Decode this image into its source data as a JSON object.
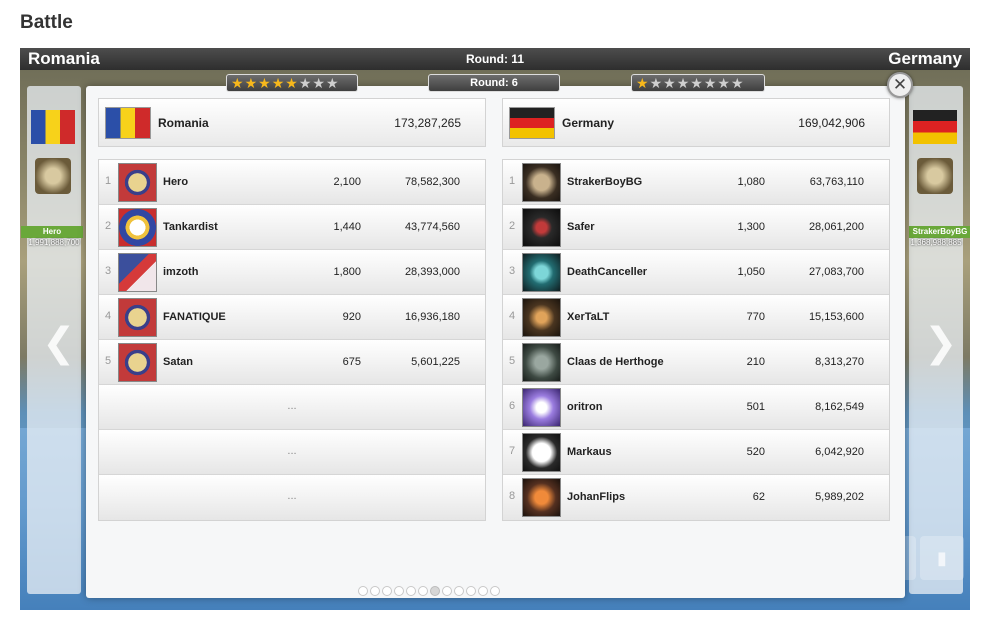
{
  "page": {
    "heading": "Battle"
  },
  "battle": {
    "attacker": "Romania",
    "defender": "Germany",
    "round_main": "Round: 11",
    "round_current": "Round: 6",
    "stars_left": {
      "filled": 5,
      "total": 8
    },
    "stars_right": {
      "filled": 1,
      "total": 8
    },
    "side_left": {
      "badge": "Hero",
      "value": "1,991,888,700"
    },
    "side_right": {
      "badge": "StrakerBoyBG",
      "value": "1,368,988,885"
    }
  },
  "left": {
    "country": "Romania",
    "total": "173,287,265",
    "flag": "romania-flag",
    "rows": [
      {
        "rank": "1",
        "name": "Hero",
        "kills": "2,100",
        "damage": "78,582,300"
      },
      {
        "rank": "2",
        "name": "Tankardist",
        "kills": "1,440",
        "damage": "43,774,560"
      },
      {
        "rank": "3",
        "name": "imzoth",
        "kills": "1,800",
        "damage": "28,393,000"
      },
      {
        "rank": "4",
        "name": "FANATIQUE",
        "kills": "920",
        "damage": "16,936,180"
      },
      {
        "rank": "5",
        "name": "Satan",
        "kills": "675",
        "damage": "5,601,225"
      }
    ],
    "empty_rows": [
      "...",
      "...",
      "..."
    ]
  },
  "right": {
    "country": "Germany",
    "total": "169,042,906",
    "flag": "germany-flag",
    "rows": [
      {
        "rank": "1",
        "name": "StrakerBoyBG",
        "kills": "1,080",
        "damage": "63,763,110"
      },
      {
        "rank": "2",
        "name": "Safer",
        "kills": "1,300",
        "damage": "28,061,200"
      },
      {
        "rank": "3",
        "name": "DeathCanceller",
        "kills": "1,050",
        "damage": "27,083,700"
      },
      {
        "rank": "4",
        "name": "XerTaLT",
        "kills": "770",
        "damage": "15,153,600"
      },
      {
        "rank": "5",
        "name": "Claas de Herthoge",
        "kills": "210",
        "damage": "8,313,270"
      },
      {
        "rank": "6",
        "name": "oritron",
        "kills": "501",
        "damage": "8,162,549"
      },
      {
        "rank": "7",
        "name": "Markaus",
        "kills": "520",
        "damage": "6,042,920"
      },
      {
        "rank": "8",
        "name": "JohanFlips",
        "kills": "62",
        "damage": "5,989,202"
      }
    ]
  },
  "pager": {
    "total": 12,
    "active_index": 6
  },
  "icons": {
    "close": "close-icon",
    "prev": "chevron-left-icon",
    "next": "chevron-right-icon",
    "stats": "bar-chart-icon"
  }
}
